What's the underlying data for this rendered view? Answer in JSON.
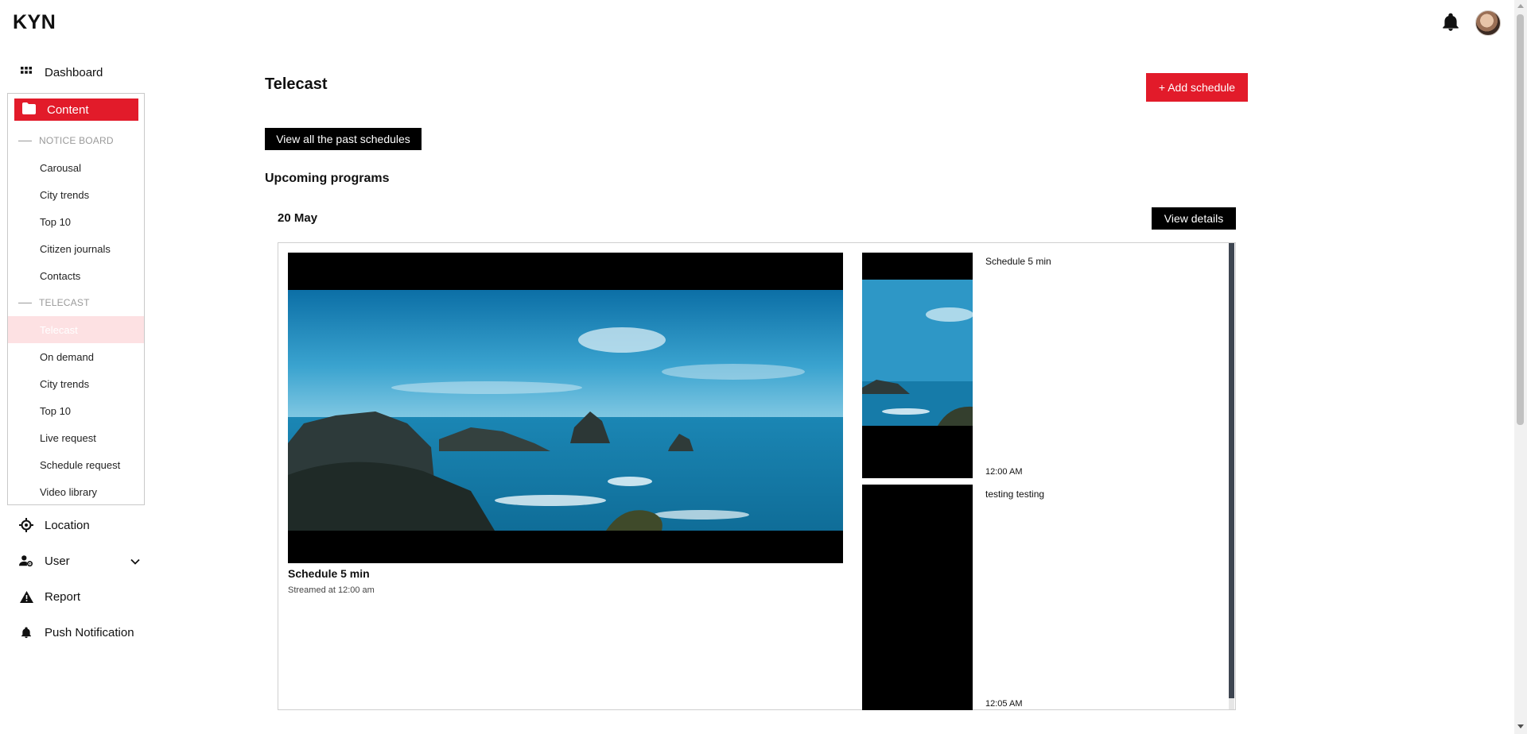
{
  "app": {
    "logo": "KYN"
  },
  "header": {
    "notification_icon": "bell-icon",
    "avatar_icon": "user-avatar"
  },
  "sidebar": {
    "dashboard": "Dashboard",
    "content": "Content",
    "notice_board": {
      "label": "NOTICE BOARD",
      "items": [
        "Carousal",
        "City trends",
        "Top 10",
        "Citizen journals",
        "Contacts"
      ]
    },
    "telecast": {
      "label": "TELECAST",
      "items": [
        "Telecast",
        "On demand",
        "City trends",
        "Top 10",
        "Live request",
        "Schedule request",
        "Video library"
      ],
      "active": "Telecast"
    },
    "location": "Location",
    "user": "User",
    "report": "Report",
    "push_notification": "Push Notification"
  },
  "main": {
    "title": "Telecast",
    "add_schedule": "+ Add schedule",
    "view_past": "View all the past schedules",
    "upcoming_heading": "Upcoming programs",
    "date": "20 May",
    "view_details": "View details",
    "featured": {
      "title": "Schedule 5 min",
      "streamed": "Streamed at 12:00 am"
    },
    "schedule_list": [
      {
        "title": "Schedule 5 min",
        "time": "12:00 AM"
      },
      {
        "title": "testing testing",
        "time": "12:05 AM"
      }
    ]
  },
  "colors": {
    "accent": "#e21b2a",
    "active_bg": "#fde1e3",
    "black": "#000000"
  }
}
